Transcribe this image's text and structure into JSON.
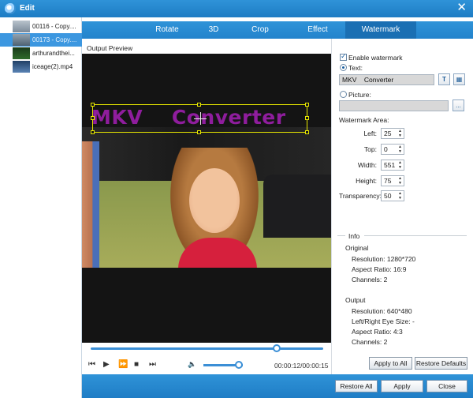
{
  "window": {
    "title": "Edit",
    "close_glyph": "✕"
  },
  "tabs": [
    {
      "label": "Rotate"
    },
    {
      "label": "3D"
    },
    {
      "label": "Crop"
    },
    {
      "label": "Effect"
    },
    {
      "label": "Watermark",
      "active": true
    }
  ],
  "files": [
    {
      "name": "00116 - Copy....",
      "thumb_icon": "video-thumbnail-icon"
    },
    {
      "name": "00173 - Copy....",
      "selected": true,
      "thumb_icon": "video-thumbnail-icon"
    },
    {
      "name": "arthurandthei...",
      "thumb_icon": "video-thumbnail-icon"
    },
    {
      "name": "iceage(2).mp4",
      "thumb_icon": "video-thumbnail-icon"
    }
  ],
  "preview": {
    "label": "Output Preview",
    "watermark_text": "MKV    Converter",
    "watermark_color": "#8f1d9d",
    "box_color": "#e8e800"
  },
  "player": {
    "seek_progress": 0.8,
    "volume_level": 0.9,
    "timecode": "00:00:12/00:00:15",
    "controls": {
      "prev": "⏮",
      "play": "▶",
      "next": "⏩",
      "stop": "■",
      "end": "⏭",
      "volume": "🔈"
    }
  },
  "watermark": {
    "enable_label": "Enable watermark",
    "enable_checked": true,
    "text_label": "Text:",
    "text_selected": true,
    "text_value": "MKV    Converter",
    "text_font_btn": "T",
    "text_color_btn": "▦",
    "picture_label": "Picture:",
    "picture_value": "",
    "browse_btn": "...",
    "area_label": "Watermark Area:",
    "left_label": "Left:",
    "left_value": "25",
    "top_label": "Top:",
    "top_value": "0",
    "width_label": "Width:",
    "width_value": "551",
    "height_label": "Height:",
    "height_value": "75",
    "transparency_label": "Transparency:",
    "transparency_value": "50"
  },
  "info": {
    "title": "Info",
    "original_label": "Original",
    "original": [
      "Resolution: 1280*720",
      "Aspect Ratio: 16:9",
      "Channels: 2"
    ],
    "output_label": "Output",
    "output": [
      "Resolution: 640*480",
      "Left/Right Eye Size: -",
      "Aspect Ratio: 4:3",
      "Channels: 2"
    ]
  },
  "buttons": {
    "apply_to_all": "Apply to All",
    "restore_defaults": "Restore Defaults",
    "restore_all": "Restore All",
    "apply": "Apply",
    "close": "Close"
  },
  "colors": {
    "accent": "#2383cc",
    "selected_row": "#3c97e0"
  }
}
